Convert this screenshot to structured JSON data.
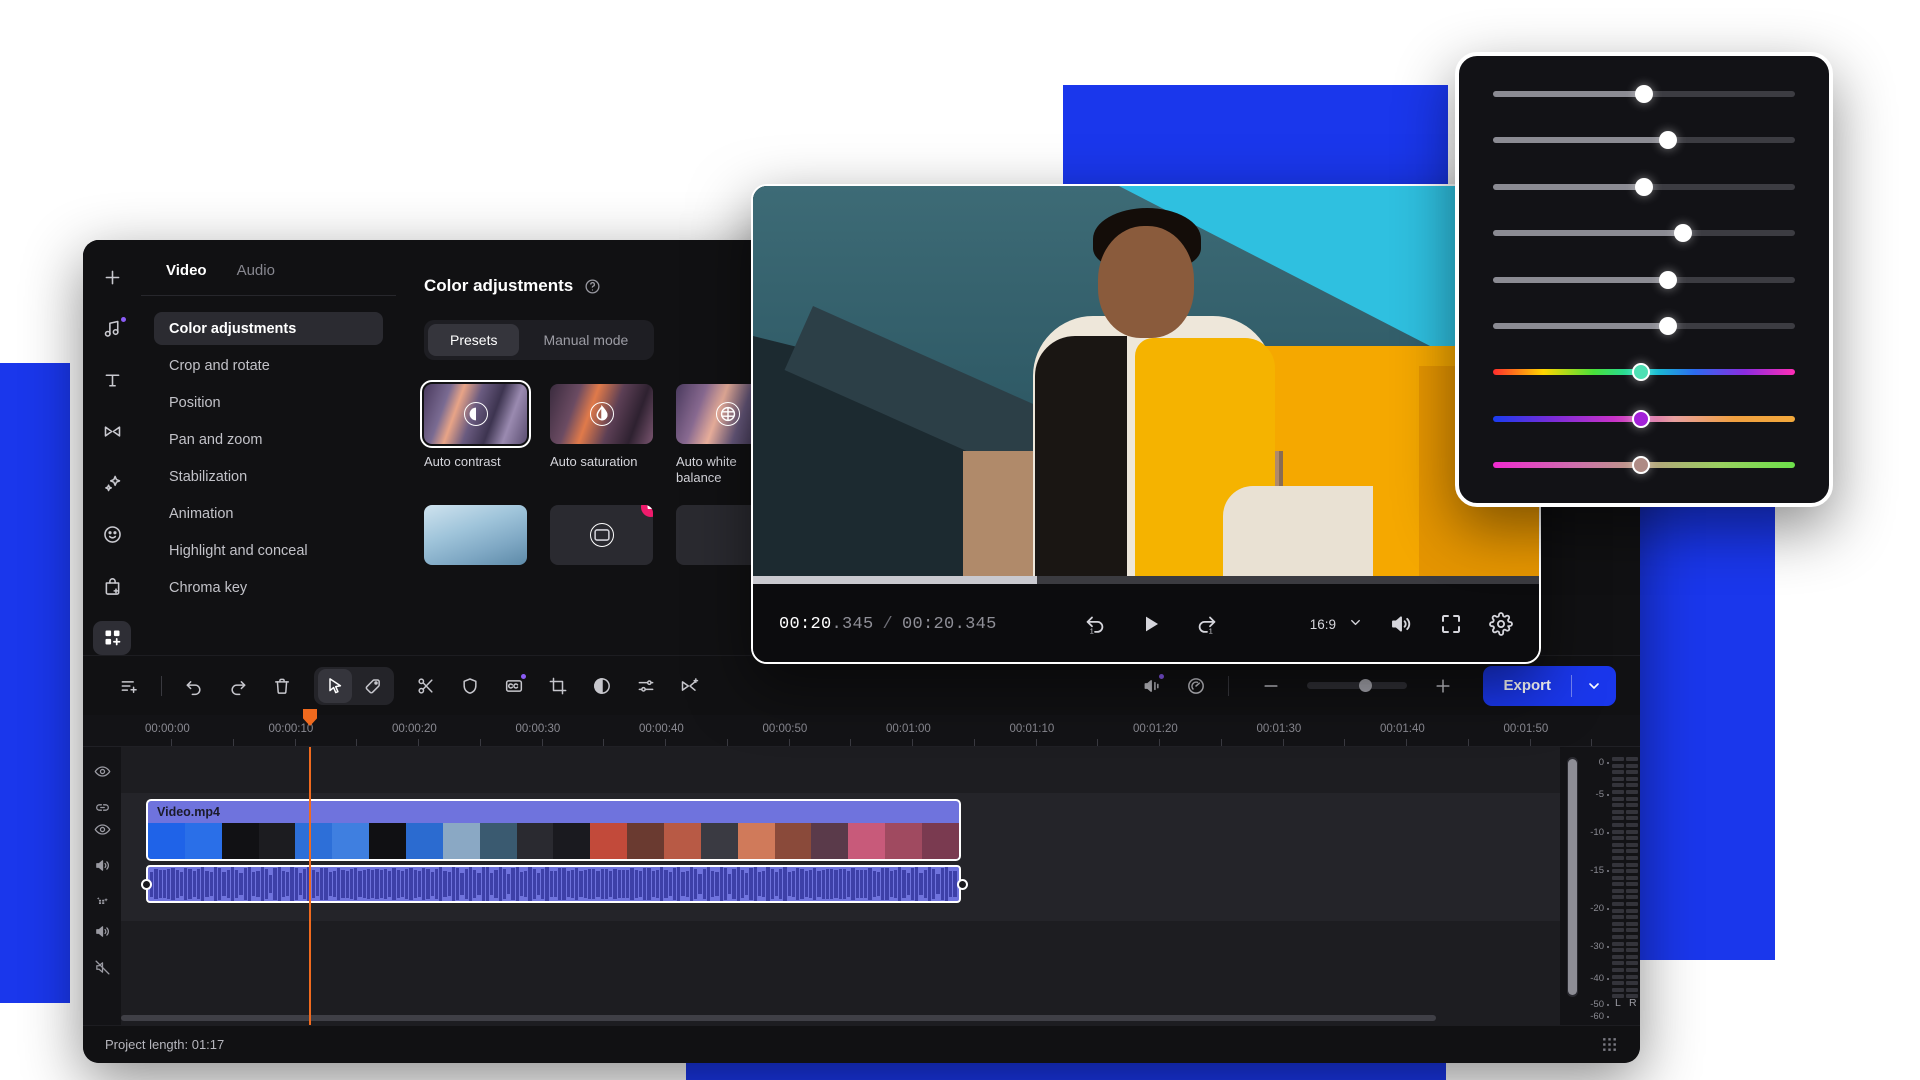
{
  "theme": {
    "accent_blue": "#1a37ec",
    "clip_color": "#6f73dd",
    "playhead_color": "#f06a1e",
    "badge_pink": "#ef1b6c",
    "badge_purple": "#8b5cf6"
  },
  "rail": {
    "items": [
      {
        "name": "add-media",
        "icon": "plus-icon",
        "badge": false
      },
      {
        "name": "audio",
        "icon": "music-note-icon",
        "badge": true
      },
      {
        "name": "titles",
        "icon": "text-t-icon",
        "badge": false
      },
      {
        "name": "transitions",
        "icon": "transition-bowtie-icon",
        "badge": false
      },
      {
        "name": "effects",
        "icon": "sparkle-icon",
        "badge": false
      },
      {
        "name": "stickers",
        "icon": "smiley-icon",
        "badge": false
      },
      {
        "name": "store",
        "icon": "bag-plus-icon",
        "badge": false
      },
      {
        "name": "more-tools",
        "icon": "grid-plus-icon",
        "badge": false
      }
    ],
    "active_index": 7
  },
  "tabs": [
    {
      "label": "Video",
      "active": true
    },
    {
      "label": "Audio",
      "active": false
    }
  ],
  "properties": {
    "items": [
      {
        "label": "Color adjustments",
        "active": true
      },
      {
        "label": "Crop and rotate",
        "active": false
      },
      {
        "label": "Position",
        "active": false
      },
      {
        "label": "Pan and zoom",
        "active": false
      },
      {
        "label": "Stabilization",
        "active": false
      },
      {
        "label": "Animation",
        "active": false
      },
      {
        "label": "Highlight and conceal",
        "active": false
      },
      {
        "label": "Chroma key",
        "active": false
      }
    ]
  },
  "color_panel": {
    "title": "Color adjustments",
    "help_icon": "question-circle-icon",
    "modes": [
      {
        "label": "Presets",
        "active": true
      },
      {
        "label": "Manual mode",
        "active": false
      }
    ],
    "presets_row1": [
      {
        "label": "Auto contrast",
        "icon": "contrast-icon",
        "selected": true,
        "premium": false,
        "thumb": "pt-a"
      },
      {
        "label": "Auto saturation",
        "icon": "droplet-icon",
        "selected": false,
        "premium": false,
        "thumb": "pt-b"
      },
      {
        "label": "Auto white balance",
        "icon": "balance-icon",
        "selected": false,
        "premium": false,
        "thumb": "pt-c"
      }
    ],
    "presets_row2": [
      {
        "label": "",
        "icon": "",
        "selected": false,
        "premium": false,
        "thumb": "pt-d"
      },
      {
        "label": "",
        "icon": "frame-icon",
        "selected": false,
        "premium": true,
        "thumb": "pt-e"
      },
      {
        "label": "",
        "icon": "",
        "selected": false,
        "premium": false,
        "thumb": "pt-f"
      }
    ]
  },
  "player": {
    "current_time": "00:20",
    "current_ms": ".345",
    "separator": "/",
    "total_time": "00:20",
    "total_ms": ".345",
    "progress_percent": 36,
    "aspect_ratio": "16:9",
    "controls": [
      {
        "name": "undo-playback",
        "icon": "arrow-undo-icon"
      },
      {
        "name": "play",
        "icon": "play-icon"
      },
      {
        "name": "redo-playback",
        "icon": "arrow-redo-icon"
      }
    ],
    "right_controls": [
      {
        "name": "volume",
        "icon": "speaker-icon"
      },
      {
        "name": "fullscreen",
        "icon": "expand-icon"
      },
      {
        "name": "settings",
        "icon": "gear-icon"
      }
    ]
  },
  "toolbar": {
    "left_icons": [
      {
        "name": "add-track",
        "icon": "add-track-icon",
        "badge": false,
        "active": false
      },
      {
        "name": "undo",
        "icon": "undo-icon",
        "badge": false,
        "active": false
      },
      {
        "name": "redo",
        "icon": "redo-icon",
        "badge": false,
        "active": false
      },
      {
        "name": "delete",
        "icon": "trash-icon",
        "badge": false,
        "active": false
      }
    ],
    "mode_group": [
      {
        "name": "select-tool",
        "icon": "cursor-arrow-icon",
        "active": true
      },
      {
        "name": "marker-tool",
        "icon": "tag-icon",
        "active": false
      }
    ],
    "edit_icons": [
      {
        "name": "split",
        "icon": "scissors-icon",
        "badge": false
      },
      {
        "name": "mask",
        "icon": "shield-icon",
        "badge": false
      },
      {
        "name": "captions",
        "icon": "cc-icon",
        "badge": true
      },
      {
        "name": "crop",
        "icon": "crop-icon",
        "badge": false
      },
      {
        "name": "color",
        "icon": "contrast-circle-icon",
        "badge": false
      },
      {
        "name": "adjust",
        "icon": "sliders-icon",
        "badge": false
      },
      {
        "name": "transition",
        "icon": "transition-plus-icon",
        "badge": false
      }
    ],
    "right_icons": [
      {
        "name": "detach-audio",
        "icon": "audio-detach-icon",
        "badge": true
      },
      {
        "name": "speed",
        "icon": "speed-icon",
        "badge": false
      }
    ],
    "zoom_out_icon": "minus-icon",
    "zoom_in_icon": "plus-icon",
    "zoom_value": 52,
    "export_label": "Export",
    "export_caret_icon": "chevron-down-icon"
  },
  "ruler": {
    "labels": [
      "00:00:00",
      "00:00:10",
      "00:00:20",
      "00:00:30",
      "00:00:40",
      "00:00:50",
      "00:01:00",
      "00:01:10",
      "00:01:20",
      "00:01:30",
      "00:01:40",
      "00:01:50"
    ]
  },
  "tracks": {
    "gutter_rows": [
      {
        "name": "track-overlay",
        "icons": [
          "eye-icon",
          "link-icon"
        ]
      },
      {
        "name": "track-video",
        "icons": [
          "eye-icon",
          "speaker-icon",
          "effects-icon"
        ]
      },
      {
        "name": "track-audio",
        "icons": [
          "speaker-icon",
          "speaker-muted-icon"
        ]
      }
    ],
    "clip": {
      "title": "Video.mp4"
    },
    "playhead_time": "00:00:13"
  },
  "meter": {
    "scale": [
      "0",
      "-5",
      "-10",
      "-15",
      "-20",
      "-30",
      "-40",
      "-50",
      "-60"
    ],
    "channels": [
      "L",
      "R"
    ]
  },
  "statusbar": {
    "project_length": "Project length: 01:17",
    "grid_icon": "grid-icon"
  },
  "slider_card": {
    "sliders": [
      {
        "name": "exposure",
        "type": "grey",
        "value": 50
      },
      {
        "name": "brightness",
        "type": "grey",
        "value": 58
      },
      {
        "name": "contrast",
        "type": "grey",
        "value": 50
      },
      {
        "name": "saturation",
        "type": "grey",
        "value": 63
      },
      {
        "name": "vibrance",
        "type": "grey",
        "value": 58
      },
      {
        "name": "highlights",
        "type": "grey",
        "value": 58
      },
      {
        "name": "hue",
        "type": "gradient",
        "gradient": "g-hue",
        "value": 49,
        "knob_color": "#4fe0b4"
      },
      {
        "name": "tint",
        "type": "gradient",
        "gradient": "g-dual",
        "value": 49,
        "knob_color": "#a321d8"
      },
      {
        "name": "temperature",
        "type": "gradient",
        "gradient": "g-mg",
        "value": 49,
        "knob_color": "#ae8b85"
      }
    ]
  }
}
